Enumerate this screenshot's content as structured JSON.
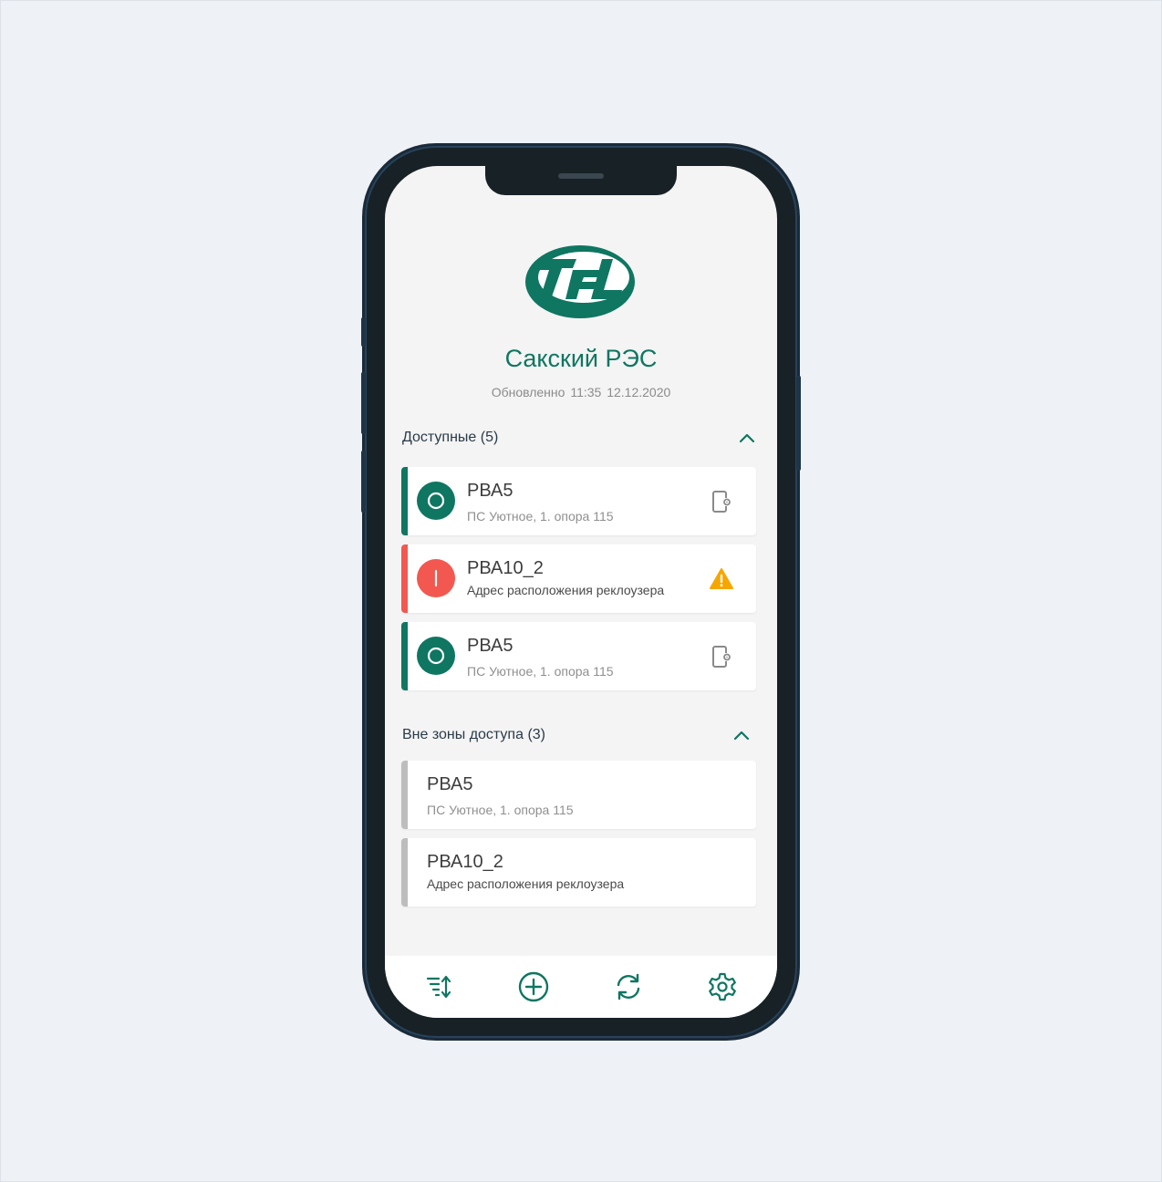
{
  "header": {
    "title": "Сакский РЭС",
    "updated_label": "Обновленно",
    "updated_time": "11:35",
    "updated_date": "12.12.2020"
  },
  "sections": [
    {
      "title": "Доступные (5)",
      "items": [
        {
          "name": "РВА5",
          "address": "ПС Уютное, 1. опора 115",
          "status": "off",
          "icon": "device-settings-icon"
        },
        {
          "name": "РВА10_2",
          "address": "Адрес расположения реклоузера",
          "status": "on",
          "icon": "warning-icon"
        },
        {
          "name": "РВА5",
          "address": "ПС Уютное, 1. опора 115",
          "status": "off",
          "icon": "device-settings-icon"
        }
      ]
    },
    {
      "title": "Вне зоны доступа (3)",
      "items": [
        {
          "name": "РВА5",
          "address": "ПС Уютное, 1. опора 115"
        },
        {
          "name": "РВА10_2",
          "address": "Адрес расположения реклоузера"
        }
      ]
    }
  ],
  "nav": [
    "sort-icon",
    "add-icon",
    "refresh-icon",
    "settings-icon"
  ],
  "colors": {
    "accent": "#0f7661",
    "alarm": "#f2584f",
    "inactive": "#bdbdbd",
    "warning": "#f5a700"
  }
}
